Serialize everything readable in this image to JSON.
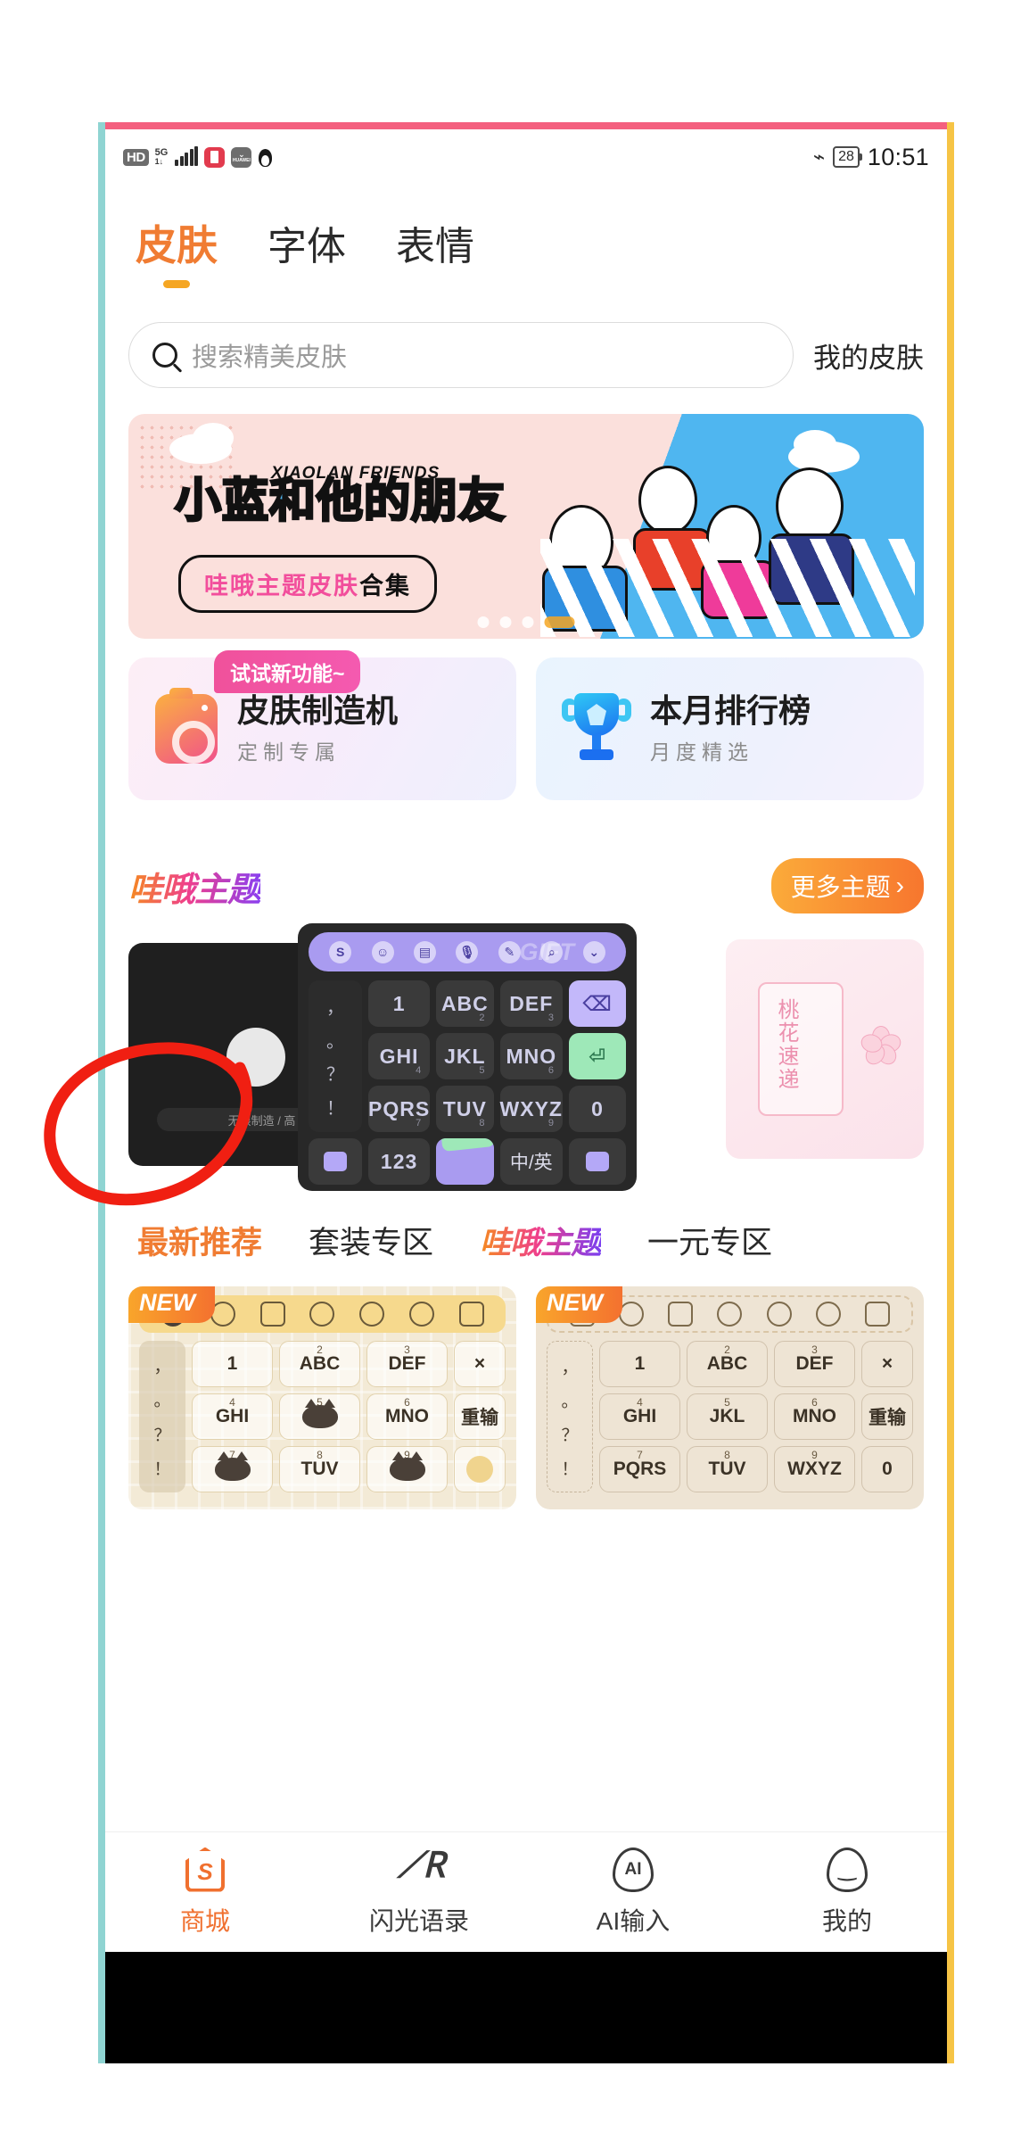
{
  "statusbar": {
    "hd": "HD",
    "network": "5G",
    "network_sub": "1↓",
    "app_icon_label": "HUAWEI",
    "bluetooth_icon": "bluetooth-icon",
    "battery": "28",
    "time": "10:51"
  },
  "top_tabs": [
    {
      "label": "皮肤",
      "active": true
    },
    {
      "label": "字体",
      "active": false
    },
    {
      "label": "表情",
      "active": false
    }
  ],
  "search": {
    "placeholder": "搜索精美皮肤",
    "my_skins_label": "我的皮肤"
  },
  "banner": {
    "title_blue": "小蓝",
    "title_mid": "和他的",
    "title_pink": "朋友",
    "english": "XIAOLAN FRIENDS",
    "subtitle_pink": "哇哦主题皮肤",
    "subtitle_dark": "合集",
    "page_count": 4,
    "active_page": 4
  },
  "feature_cards": [
    {
      "badge": "试试新功能~",
      "title": "皮肤制造机",
      "subtitle": "定制专属",
      "icon": "camera-icon"
    },
    {
      "badge": "",
      "title": "本月排行榜",
      "subtitle": "月度精选",
      "icon": "trophy-icon"
    }
  ],
  "theme_section": {
    "logo_text": "哇哦主题",
    "more_label": "更多主题",
    "more_chevron": "›"
  },
  "carousel": {
    "left_card": {
      "label": "无限制造 / 高",
      "type": "dark-device-preview"
    },
    "center_keyboard": {
      "watermark": "GIFT",
      "toolbar_icons": [
        "logo-s-icon",
        "emoji-icon",
        "keyboard-icon",
        "mic-icon",
        "pen-icon",
        "search-icon",
        "settings-icon"
      ],
      "keys": [
        {
          "label": "1",
          "sub": ""
        },
        {
          "label": "ABC",
          "sub": "2"
        },
        {
          "label": "DEF",
          "sub": "3"
        },
        {
          "label": "GHI",
          "sub": "4"
        },
        {
          "label": "JKL",
          "sub": "5"
        },
        {
          "label": "MNO",
          "sub": "6"
        },
        {
          "label": "PQRS",
          "sub": "7"
        },
        {
          "label": "TUV",
          "sub": "8"
        },
        {
          "label": "WXYZ",
          "sub": "9"
        },
        {
          "label": "0",
          "sub": ""
        }
      ],
      "punct": [
        "，",
        "。",
        "？",
        "！"
      ],
      "num_key": "123",
      "lang_key": "中/英",
      "backspace_icon": "backspace-icon",
      "enter_icon": "enter-icon"
    },
    "right_card": {
      "title": "桃花速递",
      "type": "pink-sakura-preview"
    }
  },
  "category_tabs": [
    {
      "label": "最新推荐",
      "active": true,
      "style": "text"
    },
    {
      "label": "套装专区",
      "active": false,
      "style": "text"
    },
    {
      "label": "哇哦主题",
      "active": false,
      "style": "logo"
    },
    {
      "label": "一元专区",
      "active": false,
      "style": "text"
    }
  ],
  "skins": [
    {
      "badge": "NEW",
      "theme": "cat-yellow",
      "toolbar_icons": [
        "cat-logo-icon",
        "emoji-icon",
        "keyboard-icon",
        "mic-icon",
        "pen-icon",
        "search-icon",
        "chevron-down-icon"
      ],
      "keys": [
        {
          "label": "1",
          "sub": ""
        },
        {
          "label": "ABC",
          "sub": "2"
        },
        {
          "label": "DEF",
          "sub": "3"
        },
        {
          "label": "GHI",
          "sub": "4"
        },
        {
          "label": "",
          "sub": "5"
        },
        {
          "label": "MNO",
          "sub": "6"
        },
        {
          "label": "",
          "sub": "7"
        },
        {
          "label": "TUV",
          "sub": "8"
        },
        {
          "label": "",
          "sub": "9"
        }
      ],
      "punct": [
        "，",
        "。",
        "？",
        "！"
      ],
      "side_keys": [
        "×",
        "重输",
        "○"
      ]
    },
    {
      "badge": "NEW",
      "theme": "beige-sketch",
      "toolbar_icons": [
        "logo-s-icon",
        "emoji-icon",
        "keyboard-icon",
        "mic-icon",
        "pen-icon",
        "search-icon",
        "chevron-down-icon"
      ],
      "keys": [
        {
          "label": "1",
          "sub": ""
        },
        {
          "label": "ABC",
          "sub": "2"
        },
        {
          "label": "DEF",
          "sub": "3"
        },
        {
          "label": "GHI",
          "sub": "4"
        },
        {
          "label": "JKL",
          "sub": "5"
        },
        {
          "label": "MNO",
          "sub": "6"
        },
        {
          "label": "PQRS",
          "sub": "7"
        },
        {
          "label": "TUV",
          "sub": "8"
        },
        {
          "label": "WXYZ",
          "sub": "9"
        }
      ],
      "punct": [
        "，",
        "。",
        "？",
        "！"
      ],
      "side_keys": [
        "×",
        "重输",
        "0"
      ]
    }
  ],
  "bottom_nav": [
    {
      "label": "商城",
      "icon": "sogou-house-icon",
      "active": true
    },
    {
      "label": "闪光语录",
      "icon": "quill-icon",
      "active": false
    },
    {
      "label": "AI输入",
      "icon": "ai-shield-icon",
      "active": false
    },
    {
      "label": "我的",
      "icon": "profile-shield-icon",
      "active": false
    }
  ],
  "colors": {
    "accent": "#f07c32",
    "frame_top": "#f4607f",
    "frame_left": "#8fd4d2",
    "frame_right": "#f6c445",
    "annotation": "#f01f12"
  }
}
